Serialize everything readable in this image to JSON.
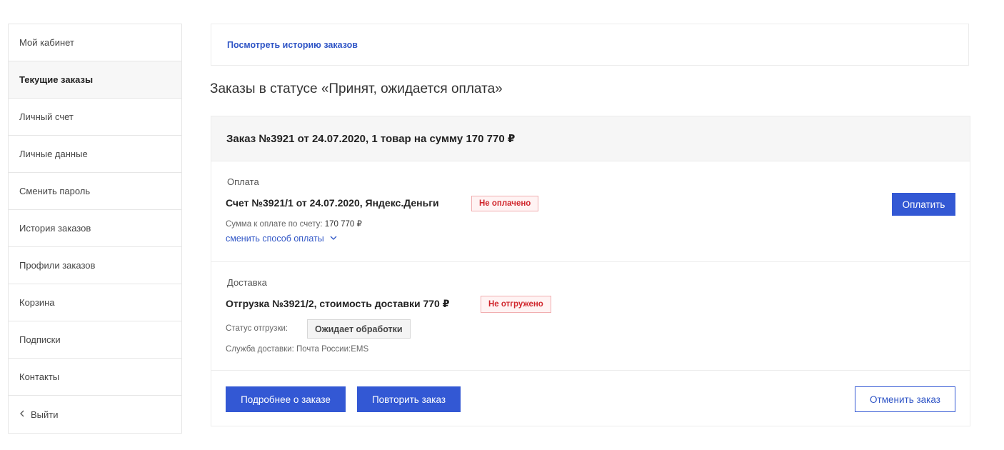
{
  "sidebar": {
    "items": [
      {
        "label": "Мой кабинет"
      },
      {
        "label": "Текущие заказы"
      },
      {
        "label": "Личный счет"
      },
      {
        "label": "Личные данные"
      },
      {
        "label": "Сменить пароль"
      },
      {
        "label": "История заказов"
      },
      {
        "label": "Профили заказов"
      },
      {
        "label": "Корзина"
      },
      {
        "label": "Подписки"
      },
      {
        "label": "Контакты"
      },
      {
        "label": "Выйти",
        "icon": "chevron-left-icon"
      }
    ],
    "active_index": 1
  },
  "history_link": "Посмотреть историю заказов",
  "section_title": "Заказы в статусе «Принят, ожидается оплата»",
  "order": {
    "header": "Заказ №3921 от 24.07.2020, 1 товар на сумму 170 770 ₽",
    "payment": {
      "label": "Оплата",
      "title": "Счет №3921/1 от 24.07.2020, Яндекс.Деньги",
      "status": "Не оплачено",
      "sum_label": "Сумма к оплате по счету:",
      "sum_value": "170 770 ₽",
      "change_link": "сменить способ оплаты",
      "pay_button": "Оплатить"
    },
    "delivery": {
      "label": "Доставка",
      "title": "Отгрузка №3921/2, стоимость доставки 770 ₽",
      "status": "Не отгружено",
      "shipment_status_label": "Статус отгрузки:",
      "shipment_status_value": "Ожидает обработки",
      "service_text": "Служба доставки: Почта России:EMS"
    },
    "buttons": {
      "details": "Подробнее о заказе",
      "repeat": "Повторить заказ",
      "cancel": "Отменить заказ"
    }
  },
  "colors": {
    "accent": "#3358d4",
    "link": "#2f55c6",
    "status_red": "#d0262c",
    "header_bg": "#f6f6f6"
  }
}
